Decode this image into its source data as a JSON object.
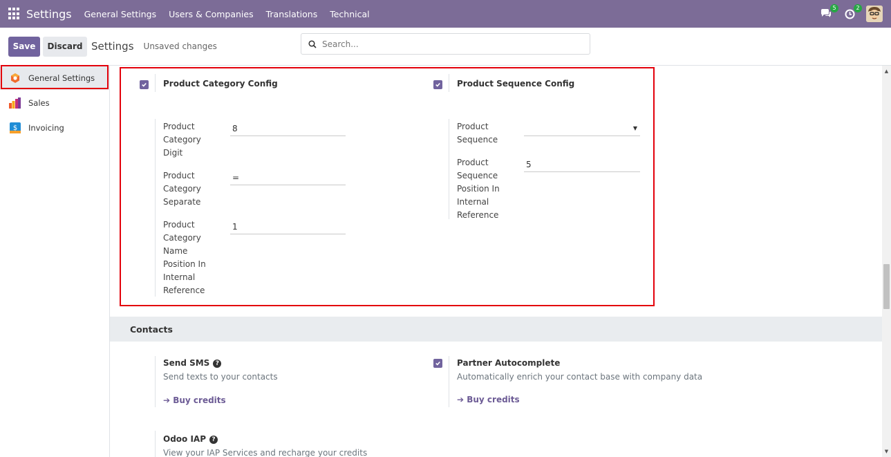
{
  "navbar": {
    "app_title": "Settings",
    "menu": [
      "General Settings",
      "Users & Companies",
      "Translations",
      "Technical"
    ],
    "messages_count": "5",
    "activities_count": "2"
  },
  "control_panel": {
    "save_label": "Save",
    "discard_label": "Discard",
    "title": "Settings",
    "unsaved": "Unsaved changes",
    "search_placeholder": "Search..."
  },
  "sidebar": {
    "items": [
      {
        "label": "General Settings",
        "icon": "general-settings-icon"
      },
      {
        "label": "Sales",
        "icon": "sales-icon"
      },
      {
        "label": "Invoicing",
        "icon": "invoicing-icon"
      }
    ]
  },
  "product_category": {
    "title": "Product Category Config",
    "checked": true,
    "fields": [
      {
        "label": "Product Category Digit",
        "value": "8"
      },
      {
        "label": "Product Category Separate",
        "value": "="
      },
      {
        "label": "Product Category Name Position In Internal Reference",
        "value": "1"
      }
    ]
  },
  "product_sequence": {
    "title": "Product Sequence Config",
    "checked": true,
    "fields": [
      {
        "label": "Product Sequence",
        "value": ""
      },
      {
        "label": "Product Sequence Position In Internal Reference",
        "value": "5"
      }
    ]
  },
  "contacts": {
    "section_title": "Contacts",
    "send_sms": {
      "title": "Send SMS",
      "desc": "Send texts to your contacts",
      "link": "Buy credits"
    },
    "partner_autocomplete": {
      "title": "Partner Autocomplete",
      "desc": "Automatically enrich your contact base with company data",
      "link": "Buy credits",
      "checked": true
    },
    "odoo_iap": {
      "title": "Odoo IAP",
      "desc": "View your IAP Services and recharge your credits"
    }
  },
  "colors": {
    "navbar": "#7c6c97",
    "primary": "#71639e",
    "highlight": "#e3000b"
  }
}
